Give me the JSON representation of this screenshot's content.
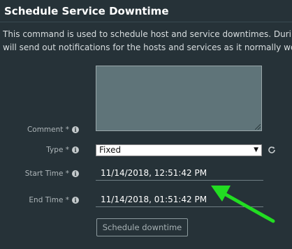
{
  "dialog": {
    "title": "Schedule Service Downtime",
    "description_line1": "This command is used to schedule host and service downtimes. During the sp",
    "description_line2": "will send out notifications for the hosts and services as it normally would. Sch"
  },
  "form": {
    "comment": {
      "label": "Comment *",
      "value": ""
    },
    "type": {
      "label": "Type *",
      "selected": "Fixed"
    },
    "start_time": {
      "label": "Start Time *",
      "value": "11/14/2018, 12:51:42 PM"
    },
    "end_time": {
      "label": "End Time *",
      "value": "11/14/2018, 01:51:42 PM"
    },
    "submit_label": "Schedule downtime"
  },
  "icons": {
    "info": "info-icon",
    "refresh": "refresh-icon",
    "dropdown": "chevron-down-icon"
  },
  "colors": {
    "background": "#263238",
    "annotation_arrow": "#22dd22"
  }
}
